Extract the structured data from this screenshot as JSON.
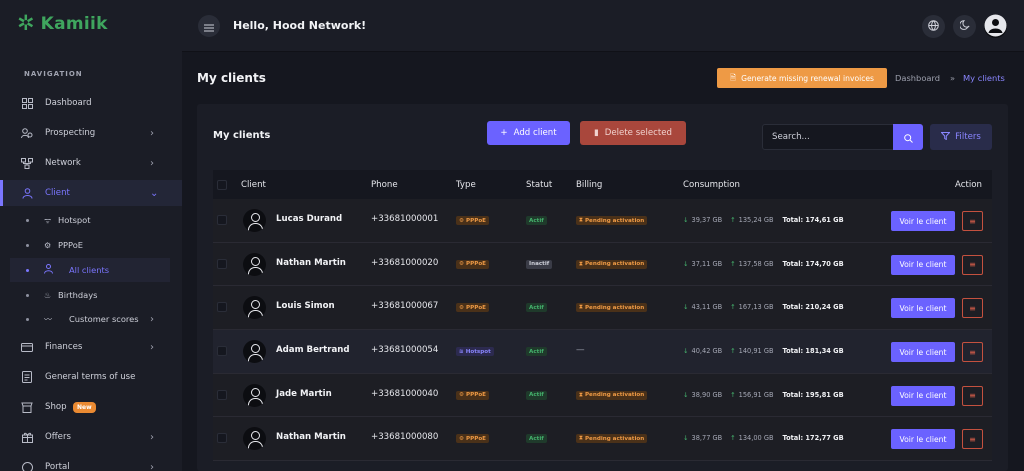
{
  "app": {
    "logo_text": "Kamiik",
    "greeting": "Hello, Hood Network!"
  },
  "sidebar": {
    "heading": "NAVIGATION",
    "items": [
      {
        "label": "Dashboard",
        "icon": "dashboard-icon"
      },
      {
        "label": "Prospecting",
        "icon": "prospecting-icon"
      },
      {
        "label": "Network",
        "icon": "network-icon"
      },
      {
        "label": "Client",
        "icon": "user-icon"
      },
      {
        "label": "Finances",
        "icon": "finances-icon"
      },
      {
        "label": "General terms of use",
        "icon": "document-icon"
      },
      {
        "label": "Shop",
        "icon": "shop-icon",
        "badge": "New"
      },
      {
        "label": "Offers",
        "icon": "offers-icon"
      },
      {
        "label": "Portal",
        "icon": "portal-icon"
      }
    ],
    "client_sub": [
      {
        "label": "Hotspot",
        "icon": "wifi-icon"
      },
      {
        "label": "PPPoE",
        "icon": "pppoe-icon"
      },
      {
        "label": "All clients",
        "icon": "user-icon"
      },
      {
        "label": "Birthdays",
        "icon": "cake-icon"
      },
      {
        "label": "Customer scores",
        "icon": "chart-icon"
      }
    ]
  },
  "page": {
    "title": "My clients",
    "renew_button": "Generate missing renewal invoices",
    "breadcrumb": {
      "parent": "Dashboard",
      "separator": "»",
      "current": "My clients"
    }
  },
  "card": {
    "title": "My clients",
    "add_button": "Add client",
    "delete_button": "Delete selected",
    "search_placeholder": "Search...",
    "filters_button": "Filters"
  },
  "table": {
    "headers": {
      "client": "Client",
      "phone": "Phone",
      "type": "Type",
      "statut": "Statut",
      "billing": "Billing",
      "consumption": "Consumption",
      "action": "Action"
    },
    "action_label": "Voir le client",
    "rows": [
      {
        "name": "Lucas Durand",
        "phone": "+33681000001",
        "type": "PPPoE",
        "status": "Actif",
        "billing": "Pending activation",
        "down": "39,37 GB",
        "up": "135,24 GB",
        "total": "Total: 174,61 GB"
      },
      {
        "name": "Nathan Martin",
        "phone": "+33681000020",
        "type": "PPPoE",
        "status": "Inactif",
        "billing": "Pending activation",
        "down": "37,11 GB",
        "up": "137,58 GB",
        "total": "Total: 174,70 GB"
      },
      {
        "name": "Louis Simon",
        "phone": "+33681000067",
        "type": "PPPoE",
        "status": "Actif",
        "billing": "Pending activation",
        "down": "43,11 GB",
        "up": "167,13 GB",
        "total": "Total: 210,24 GB"
      },
      {
        "name": "Adam Bertrand",
        "phone": "+33681000054",
        "type": "Hotspot",
        "status": "Actif",
        "billing": "—",
        "down": "40,42 GB",
        "up": "140,91 GB",
        "total": "Total: 181,34 GB"
      },
      {
        "name": "Jade Martin",
        "phone": "+33681000040",
        "type": "PPPoE",
        "status": "Actif",
        "billing": "Pending activation",
        "down": "38,90 GB",
        "up": "156,91 GB",
        "total": "Total: 195,81 GB"
      },
      {
        "name": "Nathan Martin",
        "phone": "+33681000080",
        "type": "PPPoE",
        "status": "Actif",
        "billing": "Pending activation",
        "down": "38,77 GB",
        "up": "134,00 GB",
        "total": "Total: 172,77 GB"
      }
    ]
  }
}
